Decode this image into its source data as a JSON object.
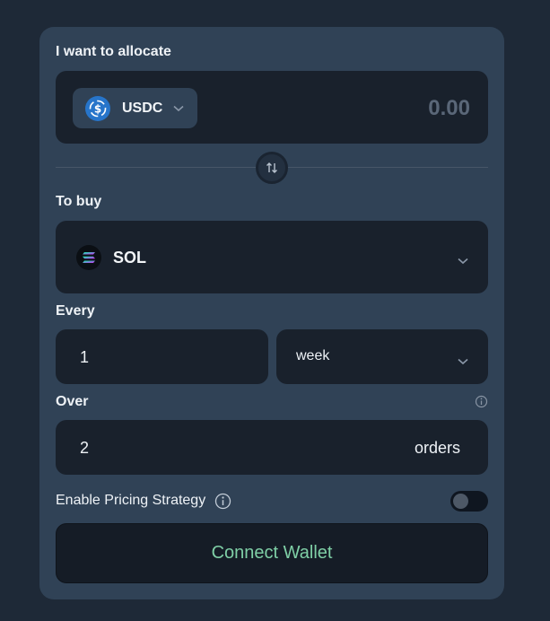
{
  "allocate": {
    "label": "I want to allocate",
    "token": "USDC",
    "amount": "0.00"
  },
  "buy": {
    "label": "To buy",
    "token": "SOL"
  },
  "every": {
    "label": "Every",
    "value": "1",
    "unit": "week"
  },
  "over": {
    "label": "Over",
    "value": "2",
    "suffix": "orders"
  },
  "pricing": {
    "label": "Enable Pricing Strategy",
    "enabled": false
  },
  "connect_label": "Connect Wallet",
  "icons": [
    "usdc-icon",
    "chevron-down-icon",
    "swap-arrows-icon",
    "solana-icon",
    "info-icon"
  ],
  "colors": {
    "background": "#1e2937",
    "card": "#304256",
    "input": "#19212c",
    "accent_text": "#7fcfa6"
  }
}
